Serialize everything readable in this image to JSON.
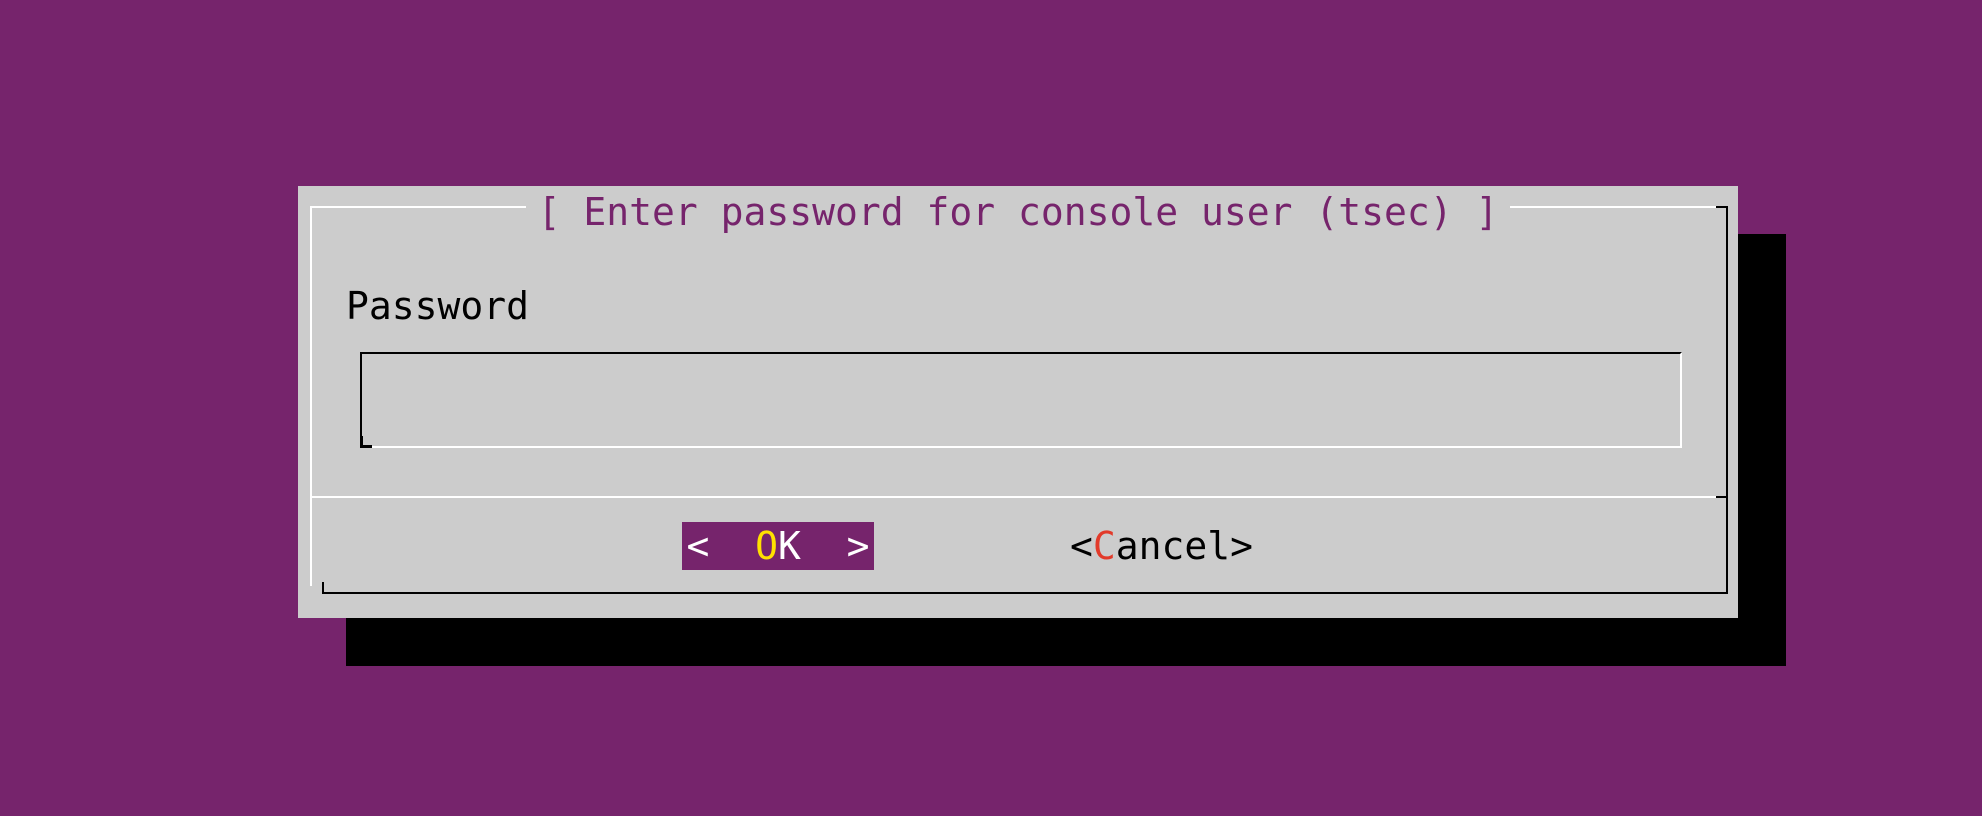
{
  "dialog": {
    "title": "[ Enter password for console user (tsec) ]",
    "field_label": "Password",
    "password_value": "",
    "ok_button": {
      "left_bracket": "<",
      "hotkey": "O",
      "rest": "K",
      "right_bracket": ">"
    },
    "cancel_button": {
      "left_bracket": "<",
      "hotkey": "C",
      "rest": "ancel",
      "right_bracket": ">"
    }
  },
  "colors": {
    "background": "#76246c",
    "dialog": "#cccccc",
    "shadow": "#000000",
    "title_text": "#76246c",
    "hotkey_selected": "#ffe000",
    "hotkey": "#e23a2a"
  }
}
